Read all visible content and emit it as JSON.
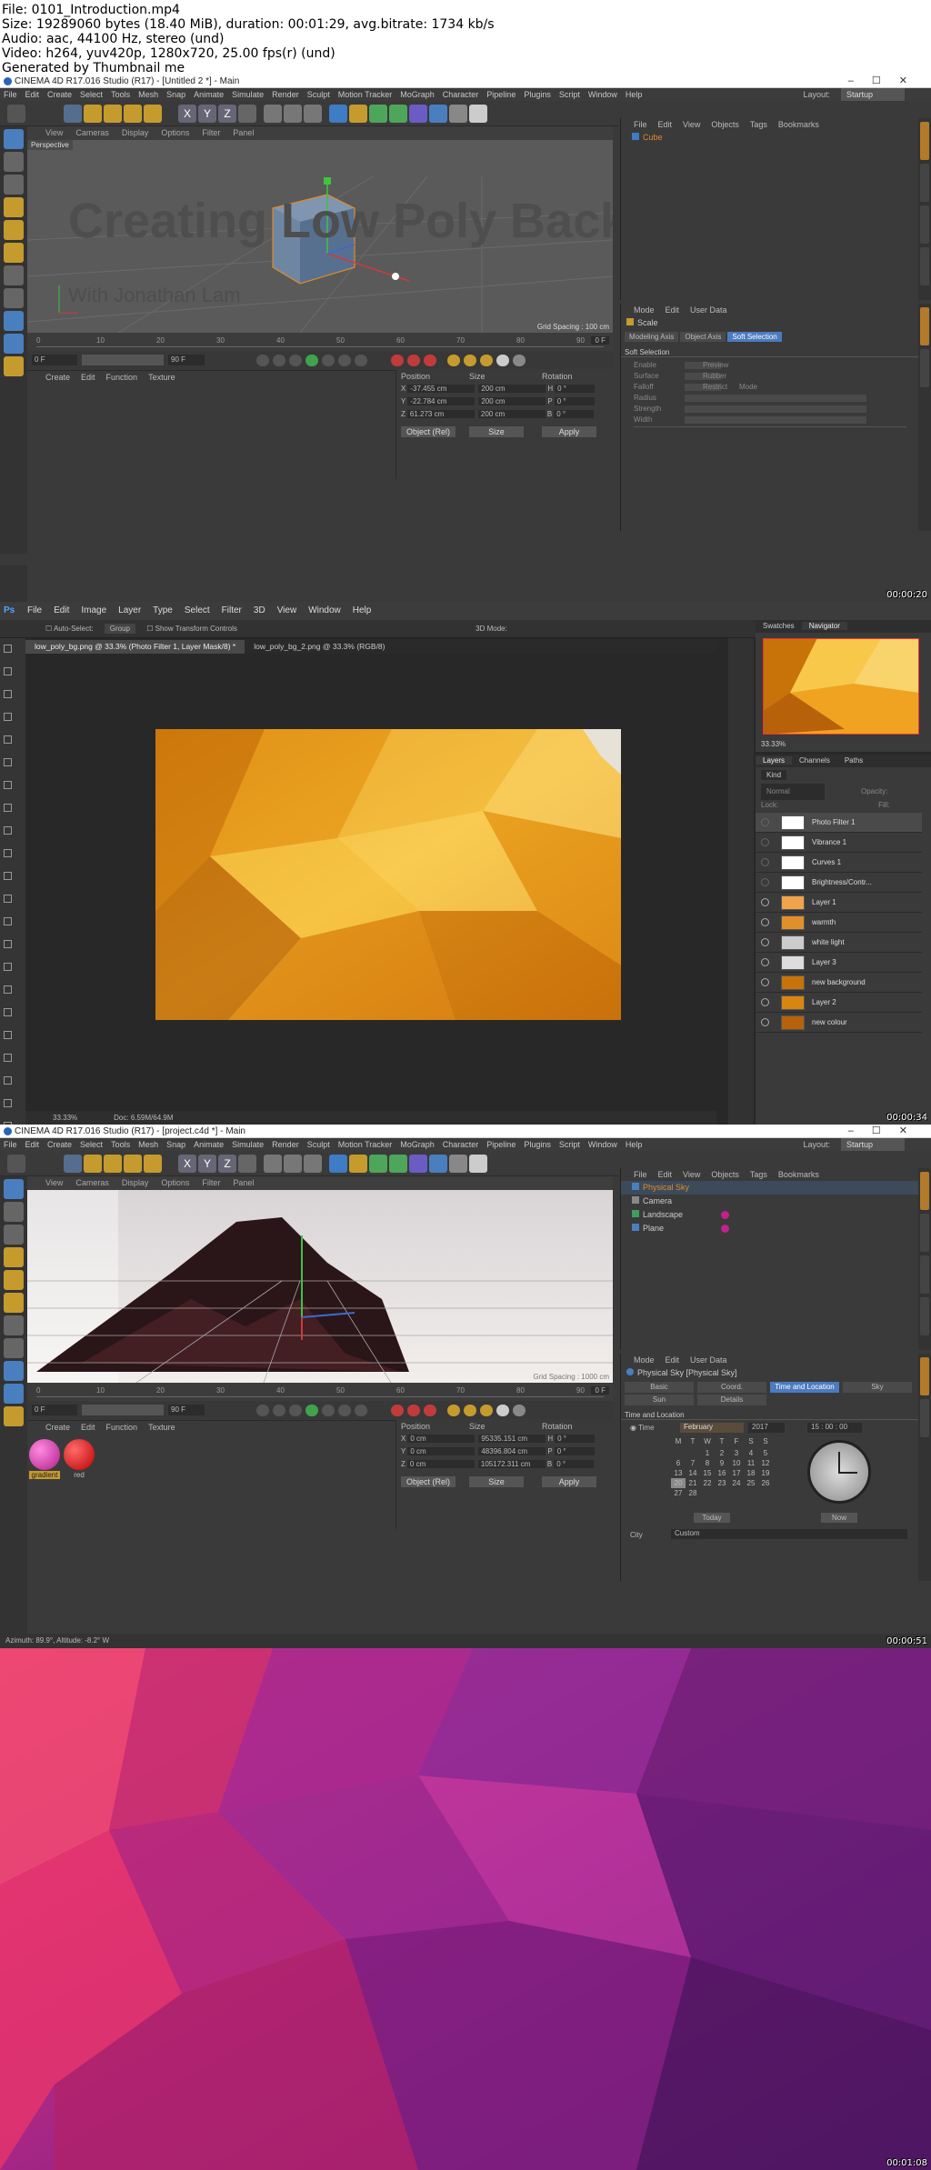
{
  "header": {
    "line1": "File: 0101_Introduction.mp4",
    "line2": "Size: 19289060 bytes (18.40 MiB), duration: 00:01:29, avg.bitrate: 1734 kb/s",
    "line3": "Audio: aac, 44100 Hz, stereo (und)",
    "line4": "Video: h264, yuv420p, 1280x720, 25.00 fps(r) (und)",
    "line5": "Generated by Thumbnail me"
  },
  "frame1": {
    "window_title": "CINEMA 4D R17.016 Studio (R17) - [Untitled 2 *] - Main",
    "menu": [
      "File",
      "Edit",
      "Create",
      "Select",
      "Tools",
      "Mesh",
      "Snap",
      "Animate",
      "Simulate",
      "Render",
      "Sculpt",
      "Motion Tracker",
      "MoGraph",
      "Character",
      "Pipeline",
      "Plugins",
      "Script",
      "Window",
      "Help"
    ],
    "layout_label": "Layout:",
    "layout_value": "Startup",
    "viewport_menu": [
      "View",
      "Cameras",
      "Display",
      "Options",
      "Filter",
      "Panel"
    ],
    "viewport_label": "Perspective",
    "overlay_title": "Creating Low Poly Backgrounds",
    "overlay_subtitle": "With Jonathan Lam",
    "grid_spacing": "Grid Spacing : 100 cm",
    "ruler": [
      "0",
      "10",
      "20",
      "30",
      "40",
      "50",
      "60",
      "70",
      "80",
      "90"
    ],
    "frame_end": "0 F",
    "start_field": "0 F",
    "end_field": "90 F",
    "mat_menu": [
      "Create",
      "Edit",
      "Function",
      "Texture"
    ],
    "obj_menu": [
      "File",
      "Edit",
      "View",
      "Objects",
      "Tags",
      "Bookmarks"
    ],
    "object_name": "Cube",
    "attr_menu": [
      "Mode",
      "Edit",
      "User Data"
    ],
    "attr_title": "Scale",
    "attr_tabs": [
      "Modeling Axis",
      "Object Axis",
      "Soft Selection"
    ],
    "attr_section": "Soft Selection",
    "attr_rows": [
      "Enable",
      "Surface",
      "Falloff",
      "Radius",
      "Strength",
      "Width"
    ],
    "attr_right": [
      "Preview",
      "Rubber",
      "Restrict",
      "Mode"
    ],
    "coord_headers": [
      "Position",
      "Size",
      "Rotation"
    ],
    "coord_rows": [
      {
        "axis": "X",
        "pos": "-37.455 cm",
        "size": "200 cm",
        "rlab": "H",
        "rot": "0 °"
      },
      {
        "axis": "Y",
        "pos": "-22.784 cm",
        "size": "200 cm",
        "rlab": "P",
        "rot": "0 °"
      },
      {
        "axis": "Z",
        "pos": "61.273 cm",
        "size": "200 cm",
        "rlab": "B",
        "rot": "0 °"
      }
    ],
    "coord_mode": "Object (Rel)",
    "coord_size_mode": "Size",
    "apply": "Apply",
    "timestamp": "00:00:20"
  },
  "frame2": {
    "menu": [
      "File",
      "Edit",
      "Image",
      "Layer",
      "Type",
      "Select",
      "Filter",
      "3D",
      "View",
      "Window",
      "Help"
    ],
    "auto_select": "Auto-Select:",
    "auto_select_value": "Group",
    "show_transform": "Show Transform Controls",
    "mode_3d": "3D Mode:",
    "tabs": [
      "low_poly_bg.png @ 33.3% (Photo Filter 1, Layer Mask/8) *",
      "low_poly_bg_2.png @ 33.3% (RGB/8)"
    ],
    "nav_tabs": [
      "Swatches",
      "Navigator"
    ],
    "zoom": "33.33%",
    "layer_tabs": [
      "Layers",
      "Channels",
      "Paths"
    ],
    "kind": "Kind",
    "blend": "Normal",
    "opacity": "Opacity:",
    "lock": "Lock:",
    "fill": "Fill:",
    "layers": [
      "Photo Filter 1",
      "Vibrance 1",
      "Curves 1",
      "Brightness/Contr...",
      "Layer 1",
      "warmth",
      "white light",
      "Layer 3",
      "new background",
      "Layer 2",
      "new colour"
    ],
    "status_zoom": "33.33%",
    "status_doc": "Doc: 6.59M/64.9M",
    "timestamp": "00:00:34"
  },
  "frame3": {
    "window_title": "CINEMA 4D R17.016 Studio (R17) - [project.c4d *] - Main",
    "menu": [
      "File",
      "Edit",
      "Create",
      "Select",
      "Tools",
      "Mesh",
      "Snap",
      "Animate",
      "Simulate",
      "Render",
      "Sculpt",
      "Motion Tracker",
      "MoGraph",
      "Character",
      "Pipeline",
      "Plugins",
      "Script",
      "Window",
      "Help"
    ],
    "layout_label": "Layout:",
    "layout_value": "Startup",
    "viewport_menu": [
      "View",
      "Cameras",
      "Display",
      "Options",
      "Filter",
      "Panel"
    ],
    "grid_spacing": "Grid Spacing : 1000 cm",
    "ruler": [
      "0",
      "10",
      "20",
      "30",
      "40",
      "50",
      "60",
      "70",
      "80",
      "90"
    ],
    "frame_end": "0 F",
    "start_field": "0 F",
    "end_field": "90 F",
    "mat_menu": [
      "Create",
      "Edit",
      "Function",
      "Texture"
    ],
    "materials": [
      "gradient",
      "red"
    ],
    "obj_menu": [
      "File",
      "Edit",
      "View",
      "Objects",
      "Tags",
      "Bookmarks"
    ],
    "objects": [
      "Physical Sky",
      "Camera",
      "Landscape",
      "Plane"
    ],
    "attr_menu": [
      "Mode",
      "Edit",
      "User Data"
    ],
    "attr_title": "Physical Sky [Physical Sky]",
    "attr_tabs": [
      "Basic",
      "Coord.",
      "Time and Location",
      "Sky",
      "Sun",
      "Details"
    ],
    "section": "Time and Location",
    "time_label": "Time",
    "month": "February",
    "year": "2017",
    "time": "15 : 00 : 00",
    "weekdays": [
      "M",
      "T",
      "W",
      "T",
      "F",
      "S",
      "S"
    ],
    "days": [
      "",
      "",
      "1",
      "2",
      "3",
      "4",
      "5",
      "6",
      "7",
      "8",
      "9",
      "10",
      "11",
      "12",
      "13",
      "14",
      "15",
      "16",
      "17",
      "18",
      "19",
      "20",
      "21",
      "22",
      "23",
      "24",
      "25",
      "26",
      "27",
      "28"
    ],
    "today": "Today",
    "now": "Now",
    "city_label": "City",
    "city_value": "Custom",
    "coord_headers": [
      "Position",
      "Size",
      "Rotation"
    ],
    "coord_rows": [
      {
        "axis": "X",
        "pos": "0 cm",
        "size": "95335.151 cm",
        "rlab": "H",
        "rot": "0 °"
      },
      {
        "axis": "Y",
        "pos": "0 cm",
        "size": "48396.804 cm",
        "rlab": "P",
        "rot": "0 °"
      },
      {
        "axis": "Z",
        "pos": "0 cm",
        "size": "105172.311 cm",
        "rlab": "B",
        "rot": "0 °"
      }
    ],
    "coord_mode": "Object (Rel)",
    "coord_size_mode": "Size",
    "apply": "Apply",
    "status": "Azimuth: 89.9°, Altitude: -8.2°  W",
    "timestamp": "00:00:51"
  },
  "frame4": {
    "timestamp": "00:01:08"
  }
}
